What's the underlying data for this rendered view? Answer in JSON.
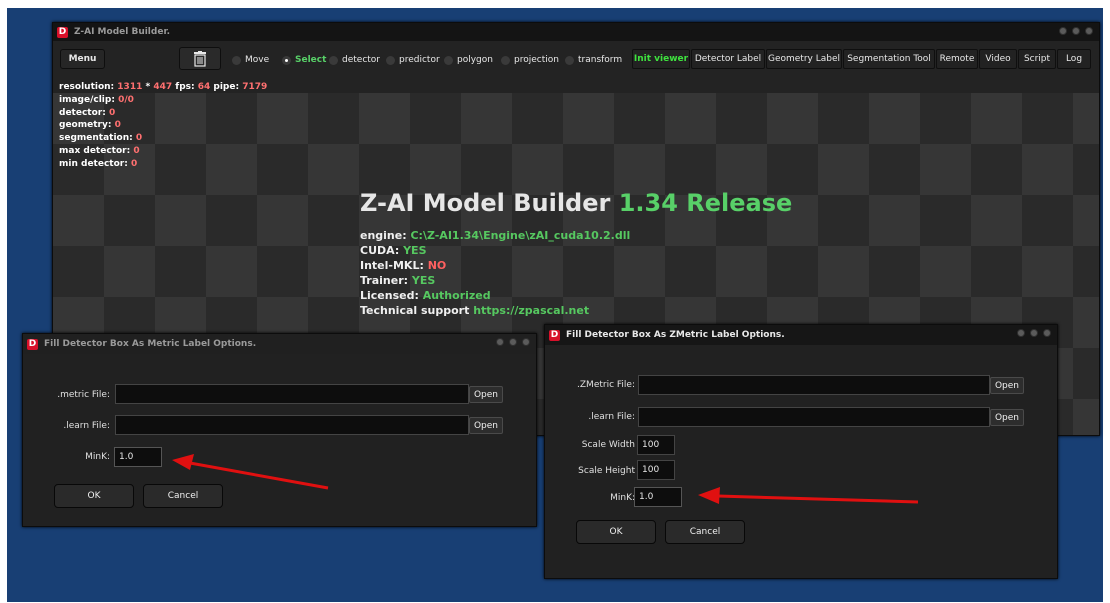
{
  "main_window": {
    "title": "Z-AI Model Builder.",
    "menu_label": "Menu",
    "trash_icon": "trash-icon",
    "modes": [
      {
        "label": "Move",
        "selected": false
      },
      {
        "label": "Select",
        "selected": true
      },
      {
        "label": "detector",
        "selected": false
      },
      {
        "label": "predictor",
        "selected": false
      },
      {
        "label": "polygon",
        "selected": false
      },
      {
        "label": "projection",
        "selected": false
      },
      {
        "label": "transform",
        "selected": false
      }
    ],
    "toolbar": [
      "Init viewer",
      "Detector Label",
      "Geometry Label",
      "Segmentation Tool",
      "Remote",
      "Video",
      "Script",
      "Log"
    ],
    "stats": {
      "resolution_label": "resolution: ",
      "res_w": "1311",
      "res_x": " * ",
      "res_h": "447",
      "fps_label": " fps: ",
      "fps": "64",
      "pipe_label": " pipe: ",
      "pipe": "7179",
      "clip_label": "image/clip: ",
      "clip": "0/0",
      "detector_label": "detector: ",
      "detector": "0",
      "geometry_label": "geometry: ",
      "geometry": "0",
      "segmentation_label": "segmentation: ",
      "segmentation": "0",
      "max_detector_label": "max detector: ",
      "max_detector": "0",
      "min_detector_label": "min detector: ",
      "min_detector": "0"
    },
    "banner": {
      "title": "Z-AI Model Builder ",
      "version": "1.34 Release",
      "engine_label": "engine: ",
      "engine": "C:\\Z-AI1.34\\Engine\\zAI_cuda10.2.dll",
      "cuda_label": "CUDA: ",
      "cuda": "YES",
      "mkl_label": "Intel-MKL: ",
      "mkl": "NO",
      "trainer_label": "Trainer: ",
      "trainer": "YES",
      "licensed_label": "Licensed: ",
      "licensed": "Authorized",
      "support_label": "Technical support ",
      "support": "https://zpascal.net"
    }
  },
  "dialog_metric": {
    "title": "Fill Detector Box As Metric Label Options.",
    "metric_file_label": ".metric File:",
    "learn_file_label": ".learn File:",
    "open_label": "Open",
    "mink_label": "MinK:",
    "mink_value": "1.0",
    "ok_label": "OK",
    "cancel_label": "Cancel"
  },
  "dialog_zmetric": {
    "title": "Fill Detector Box As ZMetric Label Options.",
    "zmetric_file_label": ".ZMetric File:",
    "learn_file_label": ".learn File:",
    "open_label": "Open",
    "scale_width_label": "Scale Width",
    "scale_width_value": "100",
    "scale_height_label": "Scale Height",
    "scale_height_value": "100",
    "mink_label": "MinK:",
    "mink_value": "1.0",
    "ok_label": "OK",
    "cancel_label": "Cancel"
  },
  "colors": {
    "desktop": "#183f74",
    "window": "#1e1e1e",
    "accent_green": "#58d068",
    "stat_red": "#ff7070",
    "arrow_red": "#e01010"
  }
}
